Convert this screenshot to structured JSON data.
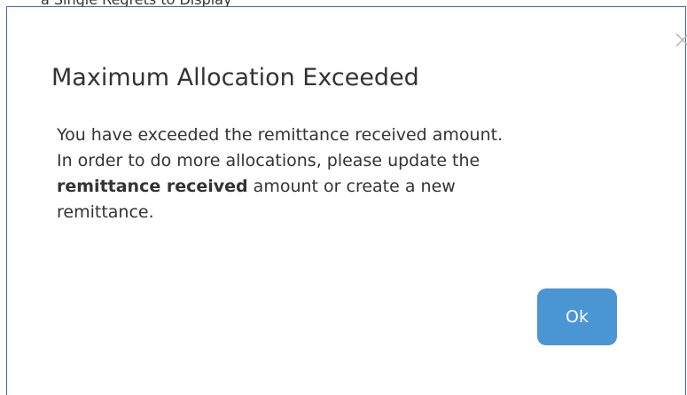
{
  "background_strip": {
    "text": "a Single Regrets to Display"
  },
  "modal": {
    "title": "Maximum Allocation Exceeded",
    "message_line_1": "You have exceeded the remittance received amount.",
    "message_line_2": "In order to do more allocations, please update the",
    "message_line_3_bold": "remittance received",
    "message_line_3_rest": " amount or create a new",
    "message_line_4": "remittance.",
    "ok_button_label": "Ok",
    "close_icon": "close-icon"
  },
  "colors": {
    "modal_border": "#3a66b5",
    "title_text": "#333333",
    "button_background": "#4a95d4",
    "button_text": "#ffffff",
    "close_icon": "#b5b5b5"
  }
}
